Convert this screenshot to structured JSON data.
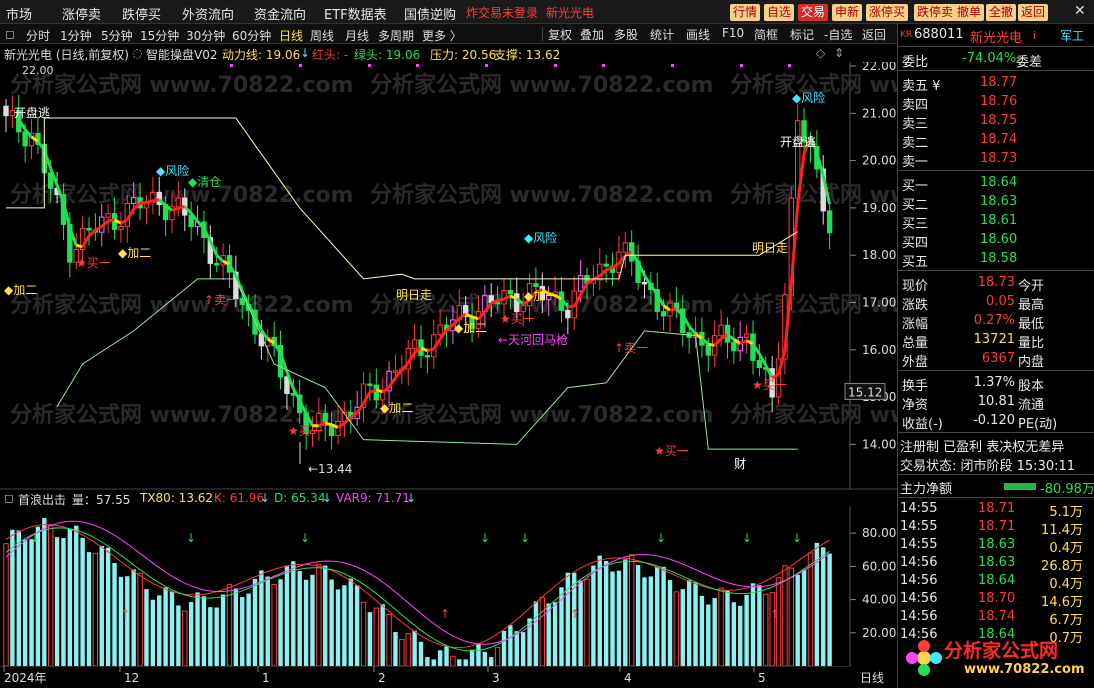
{
  "menu": {
    "items": [
      "市场",
      "涨停卖",
      "跌停买",
      "外资流向",
      "资金流向",
      "ETF数据表",
      "国债逆购"
    ],
    "alert": "炸交易未登录",
    "stock_link": "新光光电",
    "right_buttons": [
      "行情",
      "自选",
      "交易",
      "申新",
      "涨停买",
      "跌停卖",
      "撤单",
      "全撤",
      "返回"
    ],
    "close_symbol": "✕"
  },
  "toolbar": {
    "periods": [
      "分时",
      "1分钟",
      "5分钟",
      "15分钟",
      "30分钟",
      "60分钟",
      "日线",
      "周线",
      "月线",
      "多周期",
      "更多 〉"
    ],
    "active_period": "日线",
    "tools": [
      "复权",
      "叠加",
      "多股",
      "统计",
      "画线",
      "F10",
      "简框",
      "标记",
      "-自选",
      "返回"
    ]
  },
  "indicator": {
    "stock": "新光光电 (日线,前复权)",
    "name": "智能操盘V02",
    "power_label": "动力线: 19.06",
    "red_label": "红头: -",
    "green_label": "绿头: 19.06",
    "pressure_label": "压力: 20.56",
    "support_label": "支撑: 13.62"
  },
  "main_chart": {
    "price_axis": [
      "22.00",
      "21.00",
      "20.00",
      "19.00",
      "18.00",
      "17.00",
      "16.00",
      "15.00",
      "14.00"
    ],
    "current_price": "15.12",
    "top_label": "22.00",
    "low_label": "←13.44",
    "annotations": [
      {
        "text": "开盘逃",
        "color": "#ffffff"
      },
      {
        "text": "◆加二",
        "color": "#ffe14d"
      },
      {
        "text": "★买一",
        "color": "#ff3b3b"
      },
      {
        "text": "◆加二",
        "color": "#ffe14d"
      },
      {
        "text": "◆风险",
        "color": "#43e8ff"
      },
      {
        "text": "◆清仓",
        "color": "#22e055"
      },
      {
        "text": "↑卖一",
        "color": "#ff3b3b"
      },
      {
        "text": "★买一",
        "color": "#ff3b3b"
      },
      {
        "text": "◆加二",
        "color": "#ffe14d"
      },
      {
        "text": "明日走",
        "color": "#ffe14d"
      },
      {
        "text": "◆加二",
        "color": "#ffe14d"
      },
      {
        "text": "◆风险",
        "color": "#43e8ff"
      },
      {
        "text": "◆加一",
        "color": "#ffe14d"
      },
      {
        "text": "★买一",
        "color": "#ff3b3b"
      },
      {
        "text": "←天河回马枪",
        "color": "#ff44ff"
      },
      {
        "text": "↑卖一",
        "color": "#ff3b3b"
      },
      {
        "text": "★买一",
        "color": "#ff3b3b"
      },
      {
        "text": "◆风险",
        "color": "#43e8ff"
      },
      {
        "text": "开盘逃",
        "color": "#ffffff"
      },
      {
        "text": "明日走",
        "color": "#ffe14d"
      },
      {
        "text": "★买一",
        "color": "#ff3b3b"
      },
      {
        "text": "财",
        "color": "#ffffff"
      }
    ],
    "watermarks": [
      "分析家公式网",
      "www.70822.com"
    ]
  },
  "sub_chart": {
    "name": "首浪出击_量：57.55",
    "tx80": "TX80: 13.62",
    "k": "K: 61.96",
    "d": "D: 65.34",
    "var9": "VAR9: 71.71",
    "axis": [
      "80.00",
      "60.00",
      "40.00",
      "20.00"
    ]
  },
  "time_axis": {
    "labels": [
      "2024年",
      "12",
      "1",
      "2",
      "3",
      "4",
      "5"
    ],
    "right_label": "日线"
  },
  "quote": {
    "badge": "KR",
    "code": "688011",
    "name": "新光光电",
    "tag": "军工",
    "weibi_label": "委比",
    "weibi": "-74.04%",
    "weicha_label": "委差",
    "sell": [
      {
        "label": "卖五 ¥",
        "price": "18.77",
        "vol": ""
      },
      {
        "label": "卖四",
        "price": "18.76",
        "vol": ""
      },
      {
        "label": "卖三",
        "price": "18.75",
        "vol": ""
      },
      {
        "label": "卖二",
        "price": "18.74",
        "vol": ""
      },
      {
        "label": "卖一",
        "price": "18.73",
        "vol": ""
      }
    ],
    "buy": [
      {
        "label": "买一",
        "price": "18.64",
        "vol": ""
      },
      {
        "label": "买二",
        "price": "18.63",
        "vol": ""
      },
      {
        "label": "买三",
        "price": "18.61",
        "vol": ""
      },
      {
        "label": "买四",
        "price": "18.60",
        "vol": ""
      },
      {
        "label": "买五",
        "price": "18.58",
        "vol": ""
      }
    ],
    "stats": [
      {
        "l1": "现价",
        "v1": "18.73",
        "c1": "#ff3b3b",
        "l2": "今开",
        "v2": "",
        "c2": "#ff3b3b"
      },
      {
        "l1": "涨跌",
        "v1": "0.05",
        "c1": "#ff3b3b",
        "l2": "最高",
        "v2": "",
        "c2": "#ff3b3b"
      },
      {
        "l1": "涨幅",
        "v1": "0.27%",
        "c1": "#ff3b3b",
        "l2": "最低",
        "v2": "",
        "c2": "#ff3b3b"
      },
      {
        "l1": "总量",
        "v1": "13721",
        "c1": "#ffe14d",
        "l2": "量比",
        "v2": "",
        "c2": "#ffe14d"
      },
      {
        "l1": "外盘",
        "v1": "6367",
        "c1": "#ff3b3b",
        "l2": "内盘",
        "v2": "",
        "c2": "#22e055"
      }
    ],
    "stats2": [
      {
        "l1": "换手",
        "v1": "1.37%",
        "c1": "#e8e8e8",
        "l2": "股本",
        "v2": "",
        "c2": "#e8e8e8"
      },
      {
        "l1": "净资",
        "v1": "10.81",
        "c1": "#e8e8e8",
        "l2": "流通",
        "v2": "",
        "c2": "#e8e8e8"
      },
      {
        "l1": "收益(-)",
        "v1": "-0.120",
        "c1": "#e8e8e8",
        "l2": "PE(动)",
        "v2": "",
        "c2": "#e8e8e8"
      }
    ],
    "flags": "注册制  已盈利  表决权无差异",
    "status": "交易状态: 闭市阶段 15:30:11",
    "netflow_label": "主力净额",
    "netflow_value": "-80.98万"
  },
  "ticks": [
    {
      "time": "14:55",
      "price": "18.71",
      "vol": "5.1万",
      "pc": "#ff3b3b",
      "vc": "#ffe14d"
    },
    {
      "time": "14:55",
      "price": "18.71",
      "vol": "11.4万",
      "pc": "#ff3b3b",
      "vc": "#ffe14d"
    },
    {
      "time": "14:55",
      "price": "18.63",
      "vol": "0.4万",
      "pc": "#22e055",
      "vc": "#ffe14d"
    },
    {
      "time": "14:56",
      "price": "18.63",
      "vol": "26.8万",
      "pc": "#22e055",
      "vc": "#ffe14d"
    },
    {
      "time": "14:56",
      "price": "18.64",
      "vol": "0.4万",
      "pc": "#22e055",
      "vc": "#ffe14d"
    },
    {
      "time": "14:56",
      "price": "18.70",
      "vol": "14.6万",
      "pc": "#ff3b3b",
      "vc": "#ffe14d"
    },
    {
      "time": "14:56",
      "price": "18.74",
      "vol": "6.7万",
      "pc": "#ff3b3b",
      "vc": "#ffe14d"
    },
    {
      "time": "14:56",
      "price": "18.64",
      "vol": "0.7万",
      "pc": "#22e055",
      "vc": "#ffe14d"
    }
  ],
  "logo": {
    "name": "分析家公式网",
    "url": "www.70822.com"
  }
}
